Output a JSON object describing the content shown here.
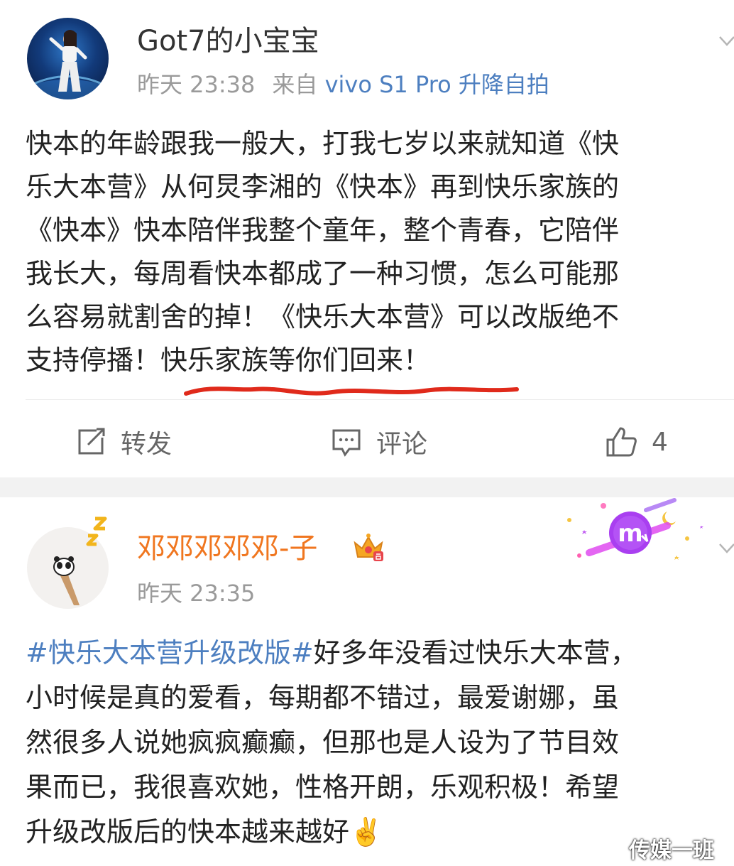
{
  "post1": {
    "username": "Got7的小宝宝",
    "time": "昨天 23:38",
    "source_prefix": "来自",
    "device": "vivo S1 Pro 升降自拍",
    "body_lines": [
      "快本的年龄跟我一般大，打我七岁以来就知道《快",
      "乐大本营》从何炅李湘的《快本》再到快乐家族的",
      "《快本》快本陪伴我整个童年，整个青春，它陪伴",
      "我长大，每周看快本都成了一种习惯，怎么可能那",
      "么容易就割舍的掉！《快乐大本营》可以改版绝不",
      "支持停播！快乐家族等你们回来！"
    ],
    "actions": {
      "repost_label": "转发",
      "comment_label": "评论",
      "like_count": "4"
    }
  },
  "post2": {
    "username": "邓邓邓邓邓-子",
    "time": "昨天 23:35",
    "hashtag": "#快乐大本营升级改版#",
    "body_first_line_rest": "好多年没看过快乐大本营，",
    "body_lines": [
      "小时候是真的爱看，每期都不错过，最爱谢娜，虽",
      "然很多人说她疯疯癫癫，但那也是人设为了节目效",
      "果而已，我很喜欢她，性格开朗，乐观积极！希望",
      "升级改版后的快本越来越好✌️"
    ]
  },
  "watermark": "传媒一班",
  "colors": {
    "link_blue": "#4d7fc0",
    "vip_orange": "#f0761f",
    "underline_red": "#e02a1b",
    "meta_gray": "#9a9a9a"
  },
  "icons": {
    "repost": "repost-icon",
    "comment": "comment-icon",
    "like": "thumbs-up-icon",
    "more": "chevron-down-icon",
    "crown": "crown-badge-icon",
    "zodiac": "scorpio-zodiac-card"
  }
}
